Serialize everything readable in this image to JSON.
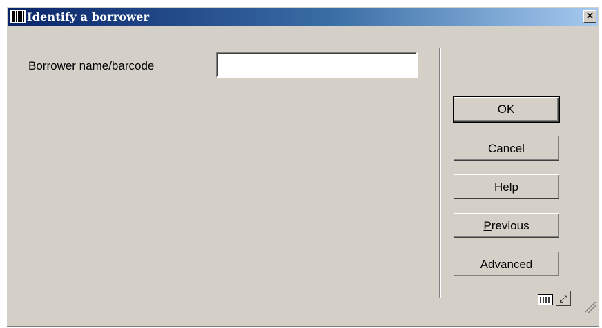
{
  "window": {
    "title": "Identify a borrower",
    "close_glyph": "×",
    "icon": "barcode-icon"
  },
  "form": {
    "label": "Borrower name/barcode",
    "input_value": ""
  },
  "buttons": {
    "ok": "OK",
    "cancel": "Cancel",
    "help_mnemonic": "H",
    "help_rest": "elp",
    "previous_mnemonic": "P",
    "previous_rest": "revious",
    "advanced_mnemonic": "A",
    "advanced_rest": "dvanced"
  },
  "status": {
    "keyboard_icon": "keyboard-icon",
    "expand_icon": "expand-icon",
    "expand_glyph": "⤢"
  },
  "colors": {
    "title_start": "#0a246a",
    "title_end": "#a6caf0",
    "face": "#d4d0c8"
  }
}
